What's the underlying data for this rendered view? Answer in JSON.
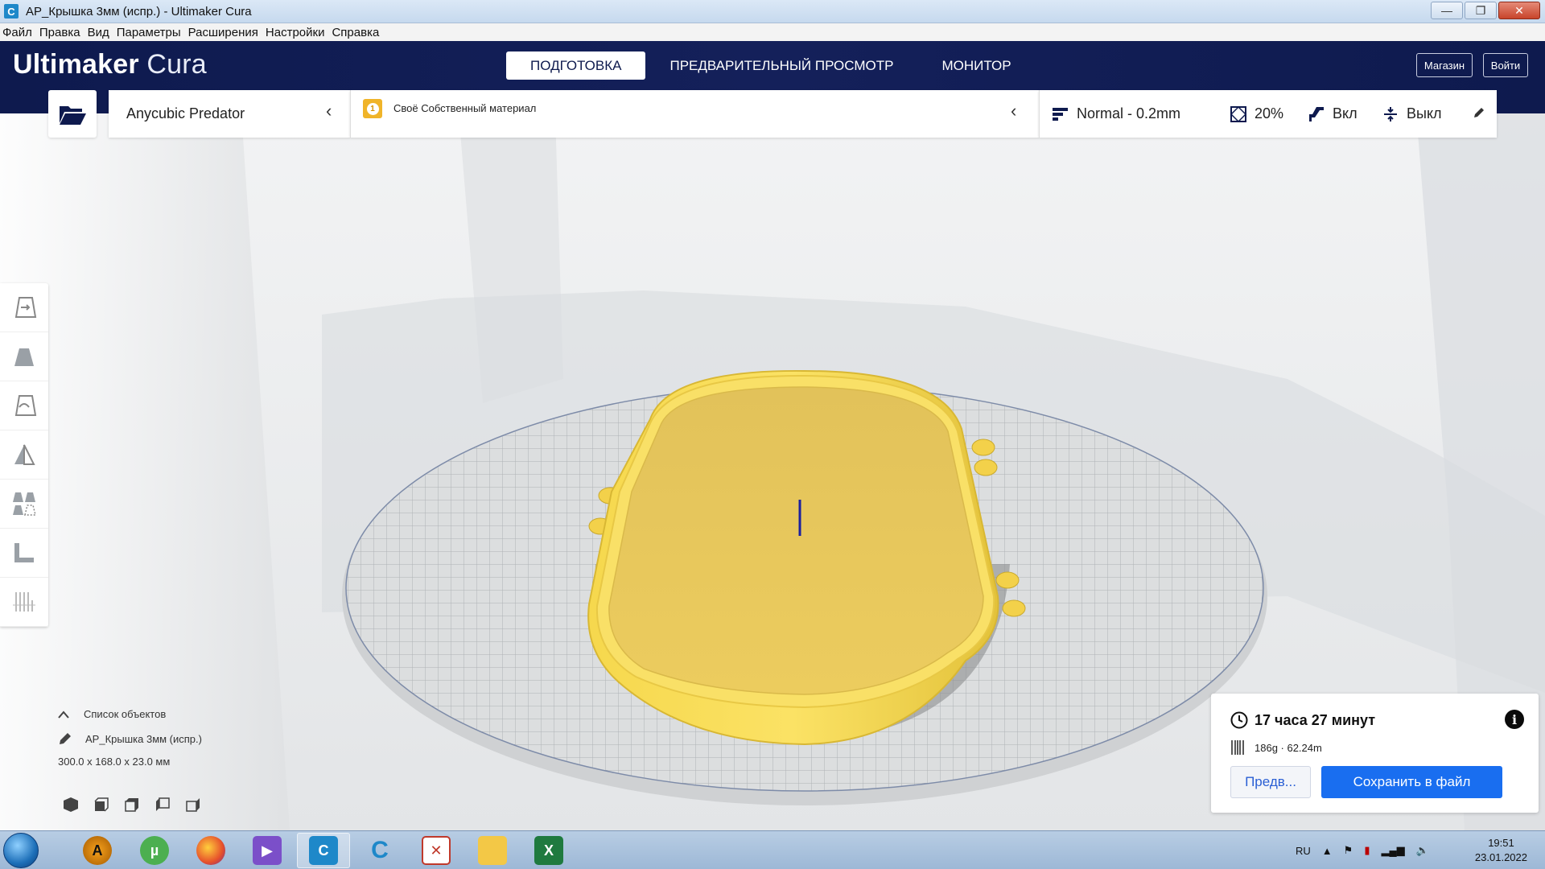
{
  "window": {
    "title": "AP_Крышка 3мм (испр.) - Ultimaker Cura",
    "min_glyph": "—",
    "max_glyph": "❐",
    "close_glyph": "✕"
  },
  "menu": [
    "Файл",
    "Правка",
    "Вид",
    "Параметры",
    "Расширения",
    "Настройки",
    "Справка"
  ],
  "header": {
    "logo_bold": "Ultimaker",
    "logo_light": "Cura",
    "tabs": [
      "ПОДГОТОВКА",
      "ПРЕДВАРИТЕЛЬНЫЙ ПРОСМОТР",
      "МОНИТОР"
    ],
    "active_tab": "ПОДГОТОВКА",
    "marketplace": "Магазин",
    "signin": "Войти"
  },
  "printer": {
    "name": "Anycubic Predator"
  },
  "material": {
    "badge": "1",
    "label": "Своё Собственный материал"
  },
  "settings": {
    "profile": "Normal - 0.2mm",
    "infill": "20%",
    "support": "Вкл",
    "adhesion": "Выкл"
  },
  "objects": {
    "header": "Список объектов",
    "name": "AP_Крышка 3мм (испр.)",
    "dimensions": "300.0 x 168.0 x 23.0 мм"
  },
  "print_info": {
    "time": "17 часа 27 минут",
    "material": "186g · 62.24m",
    "preview_label": "Предв...",
    "save_label": "Сохранить в файл",
    "info_glyph": "i"
  },
  "taskbar": {
    "lang": "RU",
    "time": "19:51",
    "date": "23.01.2022"
  },
  "colors": {
    "header_bg": "#0e1a4e",
    "accent_blue": "#196ef0",
    "model_yellow": "#f7d44c"
  }
}
